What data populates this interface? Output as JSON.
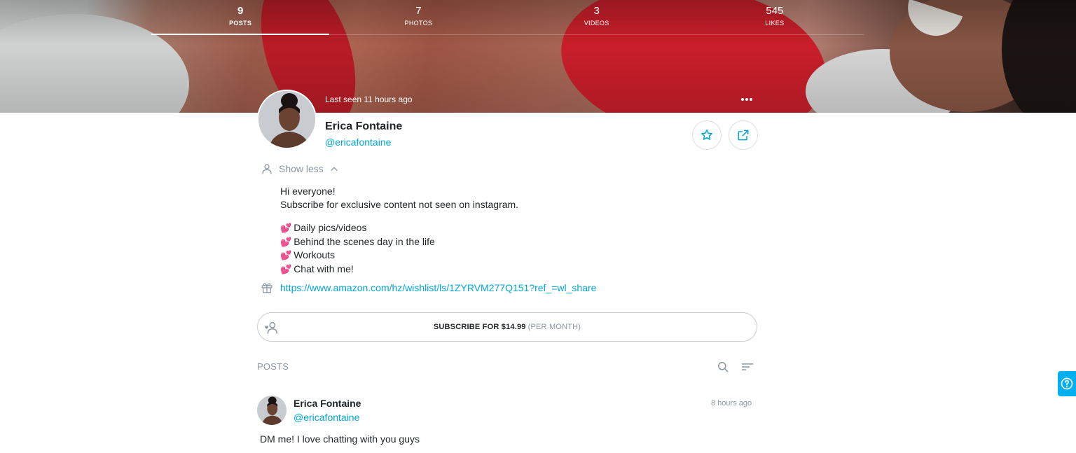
{
  "stats": [
    {
      "num": "9",
      "label": "POSTS"
    },
    {
      "num": "7",
      "label": "PHOTOS"
    },
    {
      "num": "3",
      "label": "VIDEOS"
    },
    {
      "num": "545",
      "label": "LIKES"
    }
  ],
  "active_tab": "POSTS",
  "profile": {
    "last_seen": "Last seen 11 hours ago",
    "name": "Erica Fontaine",
    "handle": "@ericafontaine",
    "show_less": "Show less"
  },
  "bio": {
    "lines": [
      "Hi everyone!",
      "Subscribe for exclusive content not seen on instagram."
    ],
    "perks": [
      "Daily pics/videos",
      "Behind the scenes day in the life",
      "Workouts",
      "Chat with me!"
    ],
    "perk_icon": "two-hearts-icon"
  },
  "wishlist": {
    "icon": "gift-icon",
    "url": "https://www.amazon.com/hz/wishlist/ls/1ZYRVM277Q151?ref_=wl_share"
  },
  "subscribe": {
    "label": "SUBSCRIBE FOR $14.99",
    "period": "(PER MONTH)"
  },
  "posts": {
    "title": "POSTS",
    "items": [
      {
        "name": "Erica Fontaine",
        "handle": "@ericafontaine",
        "time": "8 hours ago",
        "text": "DM me! I love chatting with you guys"
      }
    ]
  },
  "colors": {
    "accent": "#00a6d6",
    "muted": "#8a96a3",
    "help_button": "#00aff0"
  }
}
